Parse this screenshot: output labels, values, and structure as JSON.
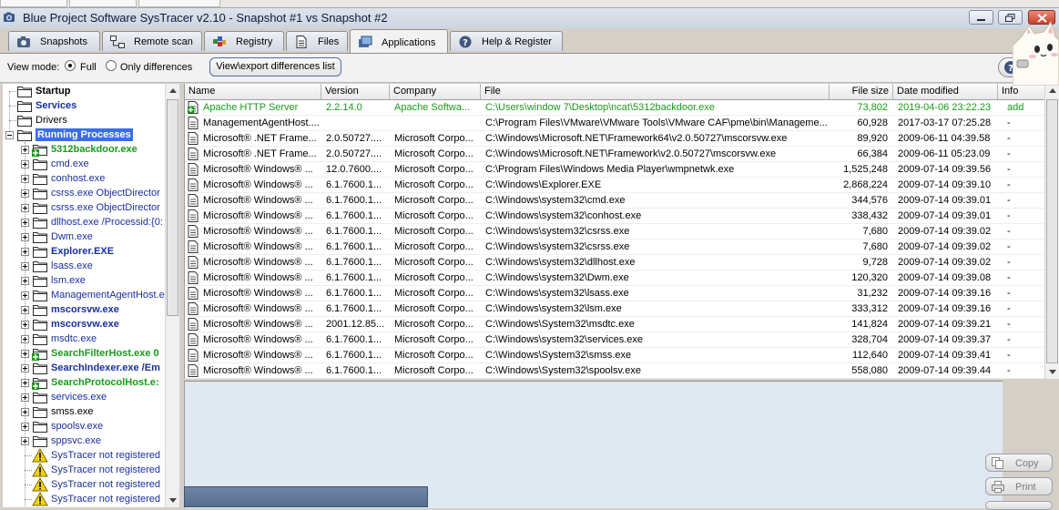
{
  "window": {
    "title": "Blue Project Software SysTracer v2.10 - Snapshot #1 vs Snapshot #2"
  },
  "tabs": [
    {
      "label": "Snapshots",
      "icon": "camera-icon"
    },
    {
      "label": "Remote scan",
      "icon": "network-icon"
    },
    {
      "label": "Registry",
      "icon": "registry-icon"
    },
    {
      "label": "Files",
      "icon": "file-icon"
    },
    {
      "label": "Applications",
      "icon": "applications-icon",
      "active": true
    },
    {
      "label": "Help & Register",
      "icon": "help-icon"
    }
  ],
  "view_mode": {
    "label": "View mode:",
    "options": [
      {
        "label": "Full",
        "selected": true
      },
      {
        "label": "Only differences",
        "selected": false
      }
    ],
    "export_button": "View\\export differences list"
  },
  "tree": {
    "items": [
      {
        "label": "Startup",
        "level": 0,
        "icon": "folder-icon",
        "bold": true,
        "color": "#000000",
        "expander": ""
      },
      {
        "label": "Services",
        "level": 0,
        "icon": "folder-icon",
        "bold": true,
        "color": "#1a2fa0",
        "expander": ""
      },
      {
        "label": "Drivers",
        "level": 0,
        "icon": "folder-icon",
        "bold": false,
        "color": "#000000",
        "expander": ""
      },
      {
        "label": "Running Processes",
        "level": 0,
        "icon": "folder-icon",
        "bold": true,
        "color": "#ffffff",
        "selected": true,
        "expander": "minus"
      },
      {
        "label": "5312backdoor.exe",
        "level": 1,
        "icon": "folder-add-icon",
        "bold": true,
        "color": "#1a9a1a",
        "expander": "plus"
      },
      {
        "label": "cmd.exe",
        "level": 1,
        "icon": "folder-icon",
        "bold": false,
        "color": "#1a2fa0",
        "expander": "plus"
      },
      {
        "label": "conhost.exe",
        "level": 1,
        "icon": "folder-icon",
        "bold": false,
        "color": "#1a2fa0",
        "expander": "plus"
      },
      {
        "label": "csrss.exe ObjectDirector",
        "level": 1,
        "icon": "folder-icon",
        "bold": false,
        "color": "#1a2fa0",
        "expander": "plus"
      },
      {
        "label": "csrss.exe ObjectDirector",
        "level": 1,
        "icon": "folder-icon",
        "bold": false,
        "color": "#1a2fa0",
        "expander": "plus"
      },
      {
        "label": "dllhost.exe /Processid:{0:",
        "level": 1,
        "icon": "folder-icon",
        "bold": false,
        "color": "#1a2fa0",
        "expander": "plus"
      },
      {
        "label": "Dwm.exe",
        "level": 1,
        "icon": "folder-icon",
        "bold": false,
        "color": "#1a2fa0",
        "expander": "plus"
      },
      {
        "label": "Explorer.EXE",
        "level": 1,
        "icon": "folder-icon",
        "bold": true,
        "color": "#1a2fa0",
        "expander": "plus"
      },
      {
        "label": "lsass.exe",
        "level": 1,
        "icon": "folder-icon",
        "bold": false,
        "color": "#1a2fa0",
        "expander": "plus"
      },
      {
        "label": "lsm.exe",
        "level": 1,
        "icon": "folder-icon",
        "bold": false,
        "color": "#1a2fa0",
        "expander": "plus"
      },
      {
        "label": "ManagementAgentHost.e",
        "level": 1,
        "icon": "folder-icon",
        "bold": false,
        "color": "#1a2fa0",
        "expander": "plus"
      },
      {
        "label": "mscorsvw.exe",
        "level": 1,
        "icon": "folder-icon",
        "bold": true,
        "color": "#1a2fa0",
        "expander": "plus"
      },
      {
        "label": "mscorsvw.exe",
        "level": 1,
        "icon": "folder-icon",
        "bold": true,
        "color": "#1a2fa0",
        "expander": "plus"
      },
      {
        "label": "msdtc.exe",
        "level": 1,
        "icon": "folder-icon",
        "bold": false,
        "color": "#1a2fa0",
        "expander": "plus"
      },
      {
        "label": "SearchFilterHost.exe 0",
        "level": 1,
        "icon": "folder-add-icon",
        "bold": true,
        "color": "#1a9a1a",
        "expander": "plus"
      },
      {
        "label": "SearchIndexer.exe /Em",
        "level": 1,
        "icon": "folder-icon",
        "bold": true,
        "color": "#1a2fa0",
        "expander": "plus"
      },
      {
        "label": "SearchProtocolHost.e:",
        "level": 1,
        "icon": "folder-add-icon",
        "bold": true,
        "color": "#1a9a1a",
        "expander": "plus"
      },
      {
        "label": "services.exe",
        "level": 1,
        "icon": "folder-icon",
        "bold": false,
        "color": "#1a2fa0",
        "expander": "plus"
      },
      {
        "label": "smss.exe",
        "level": 1,
        "icon": "folder-icon",
        "bold": false,
        "color": "#000000",
        "expander": "plus"
      },
      {
        "label": "spoolsv.exe",
        "level": 1,
        "icon": "folder-icon",
        "bold": false,
        "color": "#1a2fa0",
        "expander": "plus"
      },
      {
        "label": "sppsvc.exe",
        "level": 1,
        "icon": "folder-icon",
        "bold": false,
        "color": "#1a2fa0",
        "expander": "plus"
      },
      {
        "label": "SysTracer not registered",
        "level": 1,
        "icon": "warning-icon",
        "bold": false,
        "color": "#1a2fa0",
        "expander": ""
      },
      {
        "label": "SysTracer not registered",
        "level": 1,
        "icon": "warning-icon",
        "bold": false,
        "color": "#1a2fa0",
        "expander": ""
      },
      {
        "label": "SysTracer not registered",
        "level": 1,
        "icon": "warning-icon",
        "bold": false,
        "color": "#1a2fa0",
        "expander": ""
      },
      {
        "label": "SysTracer not registered",
        "level": 1,
        "icon": "warning-icon",
        "bold": false,
        "color": "#1a2fa0",
        "expander": ""
      }
    ]
  },
  "table": {
    "columns": [
      "Name",
      "Version",
      "Company",
      "File",
      "File size",
      "Date modified",
      "Info"
    ],
    "rows": [
      {
        "name": "Apache HTTP Server",
        "version": "2.2.14.0",
        "company": "Apache Softwa...",
        "file": "C:\\Users\\window 7\\Desktop\\ncat\\5312backdoor.exe",
        "size": "73,802",
        "date": "2019-04-06 23:22.23",
        "info": "add",
        "status": "added",
        "icon": "added-file-icon"
      },
      {
        "name": "ManagementAgentHost....",
        "version": "",
        "company": "",
        "file": "C:\\Program Files\\VMware\\VMware Tools\\VMware CAF\\pme\\bin\\Manageme...",
        "size": "60,928",
        "date": "2017-03-17 07:25.28",
        "info": "-",
        "status": "normal",
        "icon": "file-icon"
      },
      {
        "name": "Microsoft® .NET Frame...",
        "version": "2.0.50727....",
        "company": "Microsoft Corpo...",
        "file": "C:\\Windows\\Microsoft.NET\\Framework64\\v2.0.50727\\mscorsvw.exe",
        "size": "89,920",
        "date": "2009-06-11 04:39.58",
        "info": "-",
        "status": "normal",
        "icon": "file-icon"
      },
      {
        "name": "Microsoft® .NET Frame...",
        "version": "2.0.50727....",
        "company": "Microsoft Corpo...",
        "file": "C:\\Windows\\Microsoft.NET\\Framework\\v2.0.50727\\mscorsvw.exe",
        "size": "66,384",
        "date": "2009-06-11 05:23.09",
        "info": "-",
        "status": "normal",
        "icon": "file-icon"
      },
      {
        "name": "Microsoft® Windows® ...",
        "version": "12.0.7600....",
        "company": "Microsoft Corpo...",
        "file": "C:\\Program Files\\Windows Media Player\\wmpnetwk.exe",
        "size": "1,525,248",
        "date": "2009-07-14 09:39.56",
        "info": "-",
        "status": "normal",
        "icon": "file-icon"
      },
      {
        "name": "Microsoft® Windows® ...",
        "version": "6.1.7600.1...",
        "company": "Microsoft Corpo...",
        "file": "C:\\Windows\\Explorer.EXE",
        "size": "2,868,224",
        "date": "2009-07-14 09:39.10",
        "info": "-",
        "status": "normal",
        "icon": "file-icon"
      },
      {
        "name": "Microsoft® Windows® ...",
        "version": "6.1.7600.1...",
        "company": "Microsoft Corpo...",
        "file": "C:\\Windows\\system32\\cmd.exe",
        "size": "344,576",
        "date": "2009-07-14 09:39.01",
        "info": "-",
        "status": "normal",
        "icon": "file-icon"
      },
      {
        "name": "Microsoft® Windows® ...",
        "version": "6.1.7600.1...",
        "company": "Microsoft Corpo...",
        "file": "C:\\Windows\\system32\\conhost.exe",
        "size": "338,432",
        "date": "2009-07-14 09:39.01",
        "info": "-",
        "status": "normal",
        "icon": "file-icon"
      },
      {
        "name": "Microsoft® Windows® ...",
        "version": "6.1.7600.1...",
        "company": "Microsoft Corpo...",
        "file": "C:\\Windows\\system32\\csrss.exe",
        "size": "7,680",
        "date": "2009-07-14 09:39.02",
        "info": "-",
        "status": "normal",
        "icon": "file-icon"
      },
      {
        "name": "Microsoft® Windows® ...",
        "version": "6.1.7600.1...",
        "company": "Microsoft Corpo...",
        "file": "C:\\Windows\\system32\\csrss.exe",
        "size": "7,680",
        "date": "2009-07-14 09:39.02",
        "info": "-",
        "status": "normal",
        "icon": "file-icon"
      },
      {
        "name": "Microsoft® Windows® ...",
        "version": "6.1.7600.1...",
        "company": "Microsoft Corpo...",
        "file": "C:\\Windows\\system32\\dllhost.exe",
        "size": "9,728",
        "date": "2009-07-14 09:39.02",
        "info": "-",
        "status": "normal",
        "icon": "file-icon"
      },
      {
        "name": "Microsoft® Windows® ...",
        "version": "6.1.7600.1...",
        "company": "Microsoft Corpo...",
        "file": "C:\\Windows\\system32\\Dwm.exe",
        "size": "120,320",
        "date": "2009-07-14 09:39.08",
        "info": "-",
        "status": "normal",
        "icon": "file-icon"
      },
      {
        "name": "Microsoft® Windows® ...",
        "version": "6.1.7600.1...",
        "company": "Microsoft Corpo...",
        "file": "C:\\Windows\\system32\\lsass.exe",
        "size": "31,232",
        "date": "2009-07-14 09:39.16",
        "info": "-",
        "status": "normal",
        "icon": "file-icon"
      },
      {
        "name": "Microsoft® Windows® ...",
        "version": "6.1.7600.1...",
        "company": "Microsoft Corpo...",
        "file": "C:\\Windows\\system32\\lsm.exe",
        "size": "333,312",
        "date": "2009-07-14 09:39.16",
        "info": "-",
        "status": "normal",
        "icon": "file-icon"
      },
      {
        "name": "Microsoft® Windows® ...",
        "version": "2001.12.85...",
        "company": "Microsoft Corpo...",
        "file": "C:\\Windows\\System32\\msdtc.exe",
        "size": "141,824",
        "date": "2009-07-14 09:39.21",
        "info": "-",
        "status": "normal",
        "icon": "file-icon"
      },
      {
        "name": "Microsoft® Windows® ...",
        "version": "6.1.7600.1...",
        "company": "Microsoft Corpo...",
        "file": "C:\\Windows\\system32\\services.exe",
        "size": "328,704",
        "date": "2009-07-14 09:39.37",
        "info": "-",
        "status": "normal",
        "icon": "file-icon"
      },
      {
        "name": "Microsoft® Windows® ...",
        "version": "6.1.7600.1...",
        "company": "Microsoft Corpo...",
        "file": "C:\\Windows\\System32\\smss.exe",
        "size": "112,640",
        "date": "2009-07-14 09:39.41",
        "info": "-",
        "status": "normal",
        "icon": "file-icon"
      },
      {
        "name": "Microsoft® Windows® ...",
        "version": "6.1.7600.1...",
        "company": "Microsoft Corpo...",
        "file": "C:\\Windows\\System32\\spoolsv.exe",
        "size": "558,080",
        "date": "2009-07-14 09:39.44",
        "info": "-",
        "status": "normal",
        "icon": "file-icon"
      }
    ]
  },
  "side_buttons": [
    {
      "label": "Copy",
      "icon": "copy-icon"
    },
    {
      "label": "Print",
      "icon": "print-icon"
    }
  ],
  "colors": {
    "added_green": "#1a9a1a",
    "selection_blue": "#3a6ee8",
    "link_blue": "#1a2fa0"
  }
}
